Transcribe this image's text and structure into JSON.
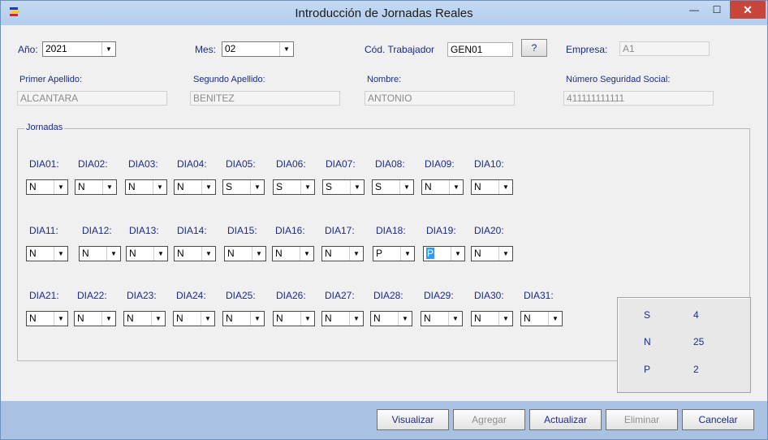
{
  "window": {
    "title": "Introducción de Jornadas Reales",
    "min": "—",
    "max": "☐",
    "close": "✕"
  },
  "header": {
    "anio_label": "Año:",
    "anio_value": "2021",
    "mes_label": "Mes:",
    "mes_value": "02",
    "cod_label": "Cód. Trabajador",
    "cod_value": "GEN01",
    "lookup_label": "?",
    "empresa_label": "Empresa:",
    "empresa_value": "A1",
    "apellido1_label": "Primer Apellido:",
    "apellido1_value": "ALCANTARA",
    "apellido2_label": "Segundo Apellido:",
    "apellido2_value": "BENITEZ",
    "nombre_label": "Nombre:",
    "nombre_value": "ANTONIO",
    "nss_label": "Número Seguridad Social:",
    "nss_value": "411111111111"
  },
  "jornadas": {
    "title": "Jornadas",
    "days": [
      {
        "label": "DIA01:",
        "value": "N"
      },
      {
        "label": "DIA02:",
        "value": "N"
      },
      {
        "label": "DIA03:",
        "value": "N"
      },
      {
        "label": "DIA04:",
        "value": "N"
      },
      {
        "label": "DIA05:",
        "value": "S"
      },
      {
        "label": "DIA06:",
        "value": "S"
      },
      {
        "label": "DIA07:",
        "value": "S"
      },
      {
        "label": "DIA08:",
        "value": "S"
      },
      {
        "label": "DIA09:",
        "value": "N"
      },
      {
        "label": "DIA10:",
        "value": "N"
      },
      {
        "label": "DIA11:",
        "value": "N"
      },
      {
        "label": "DIA12:",
        "value": "N"
      },
      {
        "label": "DIA13:",
        "value": "N"
      },
      {
        "label": "DIA14:",
        "value": "N"
      },
      {
        "label": "DIA15:",
        "value": "N"
      },
      {
        "label": "DIA16:",
        "value": "N"
      },
      {
        "label": "DIA17:",
        "value": "N"
      },
      {
        "label": "DIA18:",
        "value": "P"
      },
      {
        "label": "DIA19:",
        "value": "P"
      },
      {
        "label": "DIA20:",
        "value": "N"
      },
      {
        "label": "DIA21:",
        "value": "N"
      },
      {
        "label": "DIA22:",
        "value": "N"
      },
      {
        "label": "DIA23:",
        "value": "N"
      },
      {
        "label": "DIA24:",
        "value": "N"
      },
      {
        "label": "DIA25:",
        "value": "N"
      },
      {
        "label": "DIA26:",
        "value": "N"
      },
      {
        "label": "DIA27:",
        "value": "N"
      },
      {
        "label": "DIA28:",
        "value": "N"
      },
      {
        "label": "DIA29:",
        "value": "N"
      },
      {
        "label": "DIA30:",
        "value": "N"
      },
      {
        "label": "DIA31:",
        "value": "N"
      }
    ],
    "summary": [
      {
        "key": "S",
        "count": "4"
      },
      {
        "key": "N",
        "count": "25"
      },
      {
        "key": "P",
        "count": "2"
      }
    ]
  },
  "actions": {
    "visualizar": "Visualizar",
    "agregar": "Agregar",
    "actualizar": "Actualizar",
    "eliminar": "Eliminar",
    "cancelar": "Cancelar"
  },
  "icons": {
    "dropdown_arrow": "▼"
  }
}
